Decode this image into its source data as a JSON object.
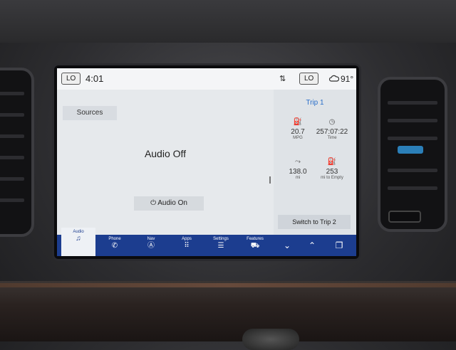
{
  "status": {
    "left_climate": "LO",
    "time": "4:01",
    "sort_icon": "arrows-updown-icon",
    "right_climate": "LO",
    "temperature": "91°",
    "weather_icon": "cloud-icon"
  },
  "audio": {
    "sources_label": "Sources",
    "state_text": "Audio Off",
    "audio_on_label": "Audio On"
  },
  "trip": {
    "title": "Trip 1",
    "metrics": [
      {
        "icon": "fuel-economy-icon",
        "value": "20.7",
        "label": "MPG"
      },
      {
        "icon": "timer-icon",
        "value": "257:07:22",
        "label": "Time"
      },
      {
        "icon": "distance-icon",
        "value": "138.0",
        "label": "mi"
      },
      {
        "icon": "fuel-pump-icon",
        "value": "253",
        "label": "mi to Empty"
      }
    ],
    "switch_label": "Switch to Trip 2"
  },
  "navbar": {
    "items": [
      {
        "label": "Audio",
        "icon": "music-note-icon",
        "active": true
      },
      {
        "label": "Phone",
        "icon": "phone-icon"
      },
      {
        "label": "Nav",
        "icon": "navigation-icon"
      },
      {
        "label": "Apps",
        "icon": "apps-grid-icon"
      },
      {
        "label": "Settings",
        "icon": "sliders-icon"
      },
      {
        "label": "Features",
        "icon": "car-icon"
      }
    ],
    "right_icons": [
      "chevron-down-icon",
      "chevron-up-icon",
      "copy-icon"
    ]
  },
  "colors": {
    "navbar_bg": "#1c3d8f",
    "accent": "#2a6fc9",
    "screen_bg": "#e9ecef"
  }
}
